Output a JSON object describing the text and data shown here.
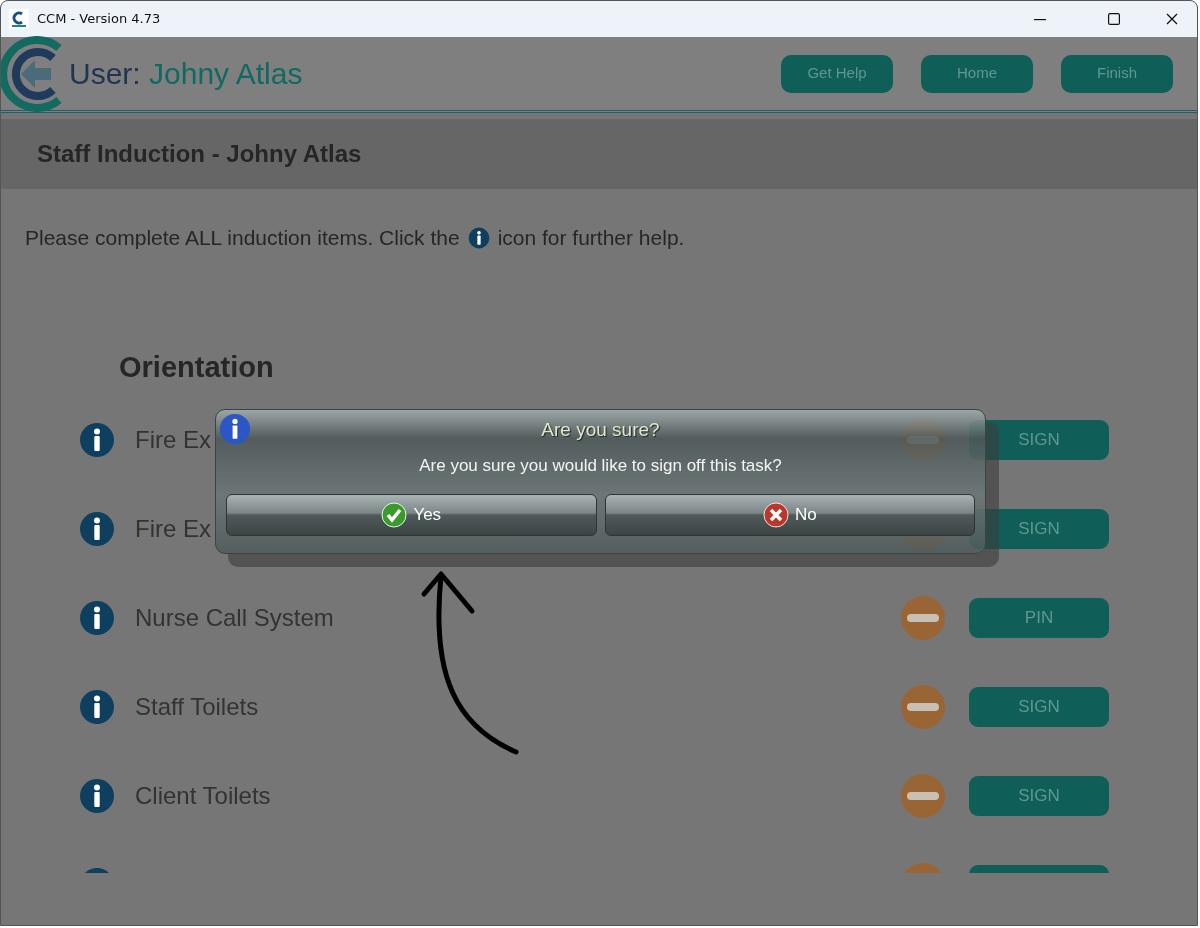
{
  "window": {
    "title": "CCM - Version 4.73"
  },
  "header": {
    "user_label": "User:",
    "user_name": "Johny Atlas",
    "buttons": [
      "Get Help",
      "Home",
      "Finish"
    ]
  },
  "section": {
    "title": "Staff Induction - Johny Atlas",
    "instruction_before": "Please complete ALL induction items.  Click the",
    "instruction_after": "icon for further help."
  },
  "group": {
    "title": "Orientation"
  },
  "items": [
    {
      "kind": "full",
      "label": "Fire Ex",
      "action": "SIGN"
    },
    {
      "kind": "full",
      "label": "Fire Ex",
      "action": "SIGN"
    },
    {
      "kind": "full",
      "label": "Nurse Call System",
      "action": "PIN"
    },
    {
      "kind": "full",
      "label": "Staff Toilets",
      "action": "SIGN"
    },
    {
      "kind": "full",
      "label": "Client Toilets",
      "action": "SIGN"
    },
    {
      "kind": "partial"
    }
  ],
  "dialog": {
    "title": "Are you sure?",
    "message": "Are you sure you would like to sign off this task?",
    "buttons": [
      {
        "kind": "yes",
        "label": "Yes"
      },
      {
        "kind": "no",
        "label": "No"
      }
    ]
  }
}
